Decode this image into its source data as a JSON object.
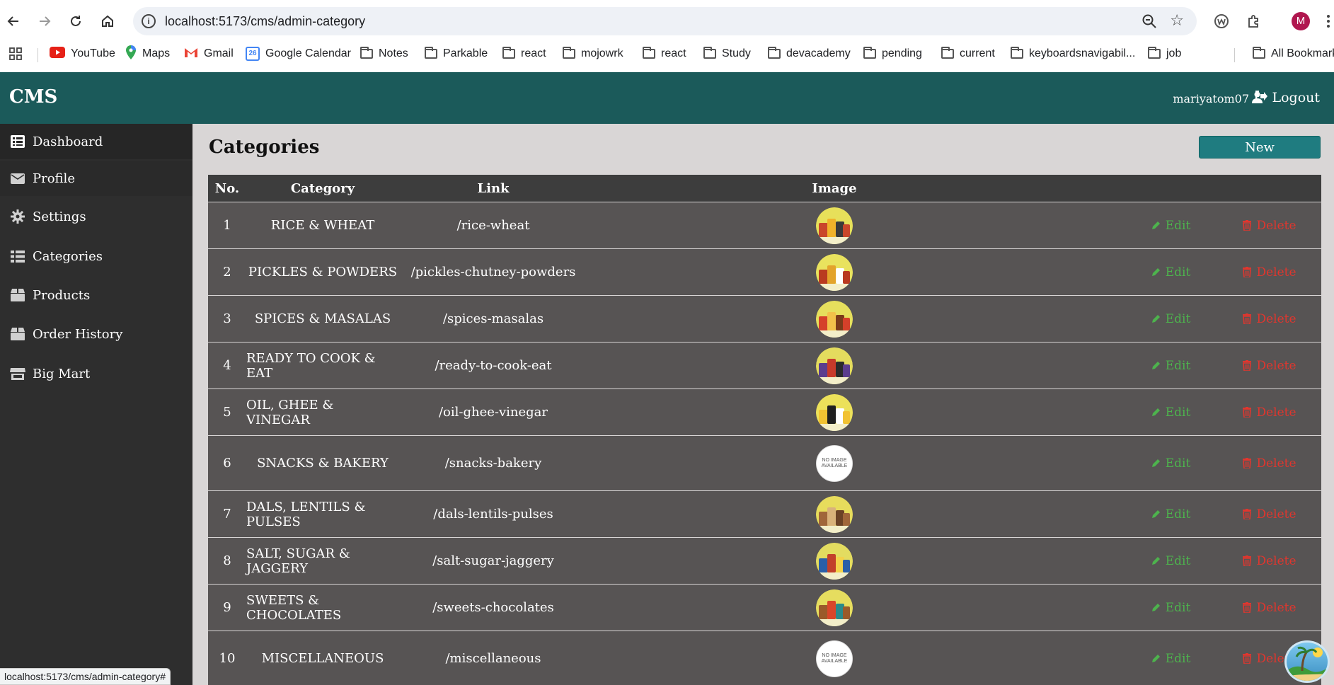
{
  "browser": {
    "url": "localhost:5173/cms/admin-category",
    "profile_initial": "M",
    "bookmarks": [
      {
        "label": "YouTube",
        "icon": "youtube-icon"
      },
      {
        "label": "Maps",
        "icon": "maps-icon"
      },
      {
        "label": "Gmail",
        "icon": "gmail-icon"
      },
      {
        "label": "Google Calendar",
        "icon": "calendar-icon"
      },
      {
        "label": "Notes",
        "icon": "folder-icon"
      },
      {
        "label": "Parkable",
        "icon": "folder-icon"
      },
      {
        "label": "react",
        "icon": "folder-icon"
      },
      {
        "label": "mojowrk",
        "icon": "folder-icon"
      },
      {
        "label": "react",
        "icon": "folder-icon"
      },
      {
        "label": "Study",
        "icon": "folder-icon"
      },
      {
        "label": "devacademy",
        "icon": "folder-icon"
      },
      {
        "label": "pending",
        "icon": "folder-icon"
      },
      {
        "label": "current",
        "icon": "folder-icon"
      },
      {
        "label": "keyboardsnavigabil...",
        "icon": "folder-icon"
      },
      {
        "label": "job",
        "icon": "folder-icon"
      }
    ],
    "all_bookmarks": "All Bookmarks",
    "calendar_day": "26",
    "status_url": "localhost:5173/cms/admin-category#"
  },
  "app": {
    "brand": "CMS",
    "username": "mariyatom07",
    "logout": "Logout",
    "accent": "#1b5a5a"
  },
  "sidebar": {
    "items": [
      {
        "label": "Dashboard",
        "icon": "list-icon"
      },
      {
        "label": "Profile",
        "icon": "envelope-icon"
      },
      {
        "label": "Settings",
        "icon": "gear-icon"
      },
      {
        "label": "Categories",
        "icon": "table-list-icon"
      },
      {
        "label": "Products",
        "icon": "box-icon"
      },
      {
        "label": "Order History",
        "icon": "box-icon"
      },
      {
        "label": "Big Mart",
        "icon": "store-icon"
      }
    ]
  },
  "main": {
    "title": "Categories",
    "new_button": "New",
    "columns": {
      "no": "No.",
      "category": "Category",
      "link": "Link",
      "image": "Image"
    },
    "edit_label": "Edit",
    "delete_label": "Delete",
    "no_image_text": "NO IMAGE AVAILABLE",
    "rows": [
      {
        "no": "1",
        "category": "RICE & WHEAT",
        "link": "/rice-wheat",
        "image": "thumbnail"
      },
      {
        "no": "2",
        "category": "PICKLES & POWDERS",
        "link": "/pickles-chutney-powders",
        "image": "thumbnail"
      },
      {
        "no": "3",
        "category": "SPICES & MASALAS",
        "link": "/spices-masalas",
        "image": "thumbnail"
      },
      {
        "no": "4",
        "category": "READY TO COOK & EAT",
        "link": "/ready-to-cook-eat",
        "image": "thumbnail"
      },
      {
        "no": "5",
        "category": "OIL, GHEE & VINEGAR",
        "link": "/oil-ghee-vinegar",
        "image": "thumbnail"
      },
      {
        "no": "6",
        "category": "SNACKS & BAKERY",
        "link": "/snacks-bakery",
        "image": "none"
      },
      {
        "no": "7",
        "category": "DALS, LENTILS & PULSES",
        "link": "/dals-lentils-pulses",
        "image": "thumbnail"
      },
      {
        "no": "8",
        "category": "SALT, SUGAR & JAGGERY",
        "link": "/salt-sugar-jaggery",
        "image": "thumbnail"
      },
      {
        "no": "9",
        "category": "SWEETS & CHOCOLATES",
        "link": "/sweets-chocolates",
        "image": "thumbnail"
      },
      {
        "no": "10",
        "category": "MISCELLANEOUS",
        "link": "/miscellaneous",
        "image": "none"
      }
    ]
  }
}
